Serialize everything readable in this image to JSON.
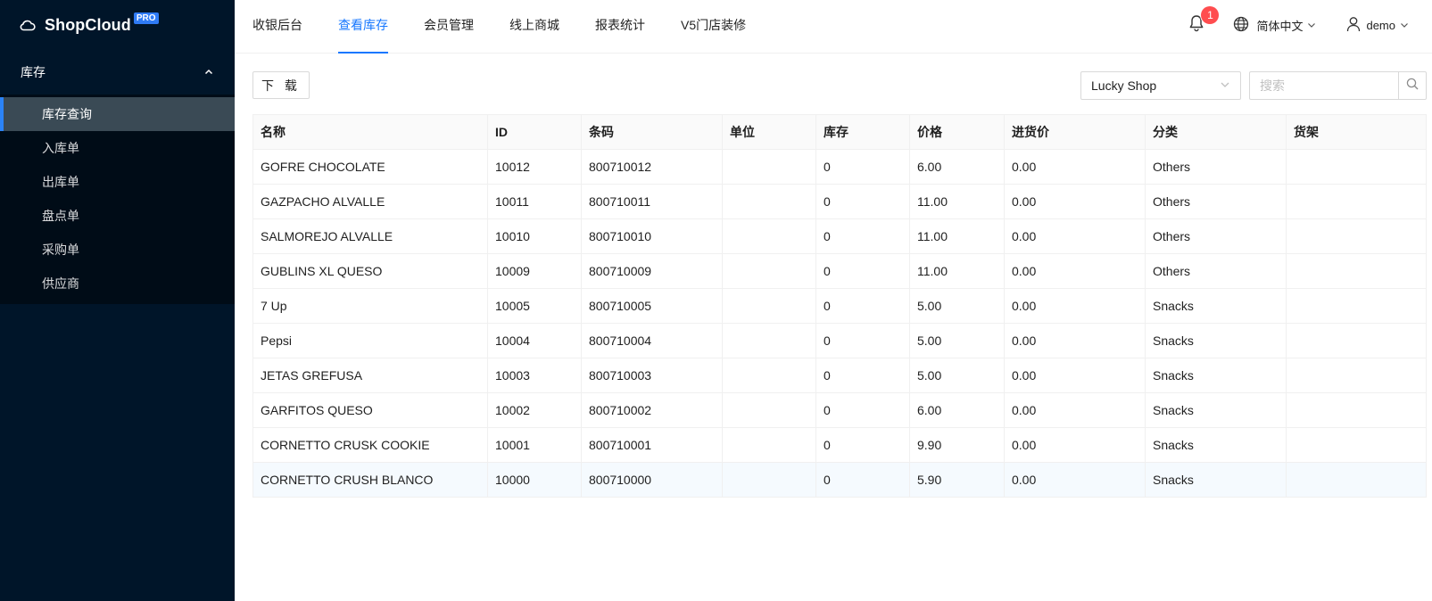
{
  "sidebar": {
    "brand": "ShopCloud",
    "brand_badge": "PRO",
    "group_label": "库存",
    "items": [
      {
        "label": "库存查询",
        "active": true
      },
      {
        "label": "入库单",
        "active": false
      },
      {
        "label": "出库单",
        "active": false
      },
      {
        "label": "盘点单",
        "active": false
      },
      {
        "label": "采购单",
        "active": false
      },
      {
        "label": "供应商",
        "active": false
      }
    ]
  },
  "header": {
    "tabs": [
      {
        "label": "收银后台",
        "active": false
      },
      {
        "label": "查看库存",
        "active": true
      },
      {
        "label": "会员管理",
        "active": false
      },
      {
        "label": "线上商城",
        "active": false
      },
      {
        "label": "报表统计",
        "active": false
      },
      {
        "label": "V5门店装修",
        "active": false
      }
    ],
    "notification_count": "1",
    "language": "简体中文",
    "user": "demo"
  },
  "toolbar": {
    "download_label": "下 载",
    "shop_selected": "Lucky Shop",
    "search_placeholder": "搜索"
  },
  "table": {
    "columns": [
      "名称",
      "ID",
      "条码",
      "单位",
      "库存",
      "价格",
      "进货价",
      "分类",
      "货架"
    ],
    "rows": [
      [
        "GOFRE CHOCOLATE",
        "10012",
        "800710012",
        "",
        "0",
        "6.00",
        "0.00",
        "Others",
        ""
      ],
      [
        "GAZPACHO ALVALLE",
        "10011",
        "800710011",
        "",
        "0",
        "11.00",
        "0.00",
        "Others",
        ""
      ],
      [
        "SALMOREJO ALVALLE",
        "10010",
        "800710010",
        "",
        "0",
        "11.00",
        "0.00",
        "Others",
        ""
      ],
      [
        "GUBLINS XL QUESO",
        "10009",
        "800710009",
        "",
        "0",
        "11.00",
        "0.00",
        "Others",
        ""
      ],
      [
        "7 Up",
        "10005",
        "800710005",
        "",
        "0",
        "5.00",
        "0.00",
        "Snacks",
        ""
      ],
      [
        "Pepsi",
        "10004",
        "800710004",
        "",
        "0",
        "5.00",
        "0.00",
        "Snacks",
        ""
      ],
      [
        "JETAS GREFUSA",
        "10003",
        "800710003",
        "",
        "0",
        "5.00",
        "0.00",
        "Snacks",
        ""
      ],
      [
        "GARFITOS QUESO",
        "10002",
        "800710002",
        "",
        "0",
        "6.00",
        "0.00",
        "Snacks",
        ""
      ],
      [
        "CORNETTO CRUSK COOKIE",
        "10001",
        "800710001",
        "",
        "0",
        "9.90",
        "0.00",
        "Snacks",
        ""
      ],
      [
        "CORNETTO CRUSH BLANCO",
        "10000",
        "800710000",
        "",
        "0",
        "5.90",
        "0.00",
        "Snacks",
        ""
      ]
    ]
  },
  "colors": {
    "sidebar_bg": "#001529",
    "accent": "#1677ff",
    "badge": "#ff4d4f"
  }
}
